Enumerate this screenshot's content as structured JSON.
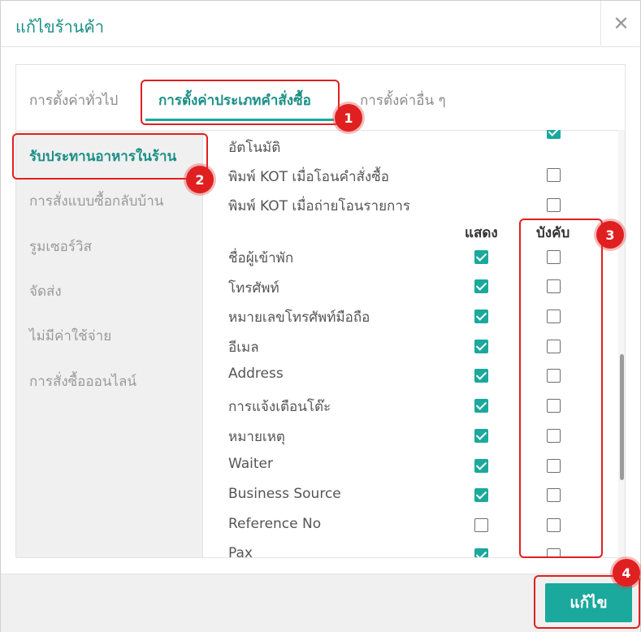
{
  "dialog": {
    "title": "แก้ไขร้านค้า",
    "close_symbol": "✕"
  },
  "tabs": [
    {
      "label": "การตั้งค่าทั่วไป",
      "active": false
    },
    {
      "label": "การตั้งค่าประเภทคำสั่งซื้อ",
      "active": true
    },
    {
      "label": "การตั้งค่าอื่น ๆ",
      "active": false
    }
  ],
  "sidebar": {
    "items": [
      {
        "label": "รับประทานอาหารในร้าน",
        "active": true
      },
      {
        "label": "การสั่งแบบซื้อกลับบ้าน",
        "active": false
      },
      {
        "label": "รูมเซอร์วิส",
        "active": false
      },
      {
        "label": "จัดส่ง",
        "active": false
      },
      {
        "label": "ไม่มีค่าใช้จ่าย",
        "active": false
      },
      {
        "label": "การสั่งซื้อออนไลน์",
        "active": false
      }
    ]
  },
  "settings": [
    {
      "label": "อัตโนมัติ",
      "checked": true
    },
    {
      "label": "พิมพ์ KOT เมื่อโอนคำสั่งซื้อ",
      "checked": false
    },
    {
      "label": "พิมพ์ KOT เมื่อถ่ายโอนรายการ",
      "checked": false
    }
  ],
  "columns": {
    "show": "แสดง",
    "required": "บังคับ"
  },
  "fields": [
    {
      "label": "ชื่อผู้เข้าพัก",
      "show": true,
      "required": false
    },
    {
      "label": "โทรศัพท์",
      "show": true,
      "required": false
    },
    {
      "label": "หมายเลขโทรศัพท์มือถือ",
      "show": true,
      "required": false
    },
    {
      "label": "อีเมล",
      "show": true,
      "required": false
    },
    {
      "label": "Address",
      "show": true,
      "required": false
    },
    {
      "label": "การแจ้งเตือนโต๊ะ",
      "show": true,
      "required": false
    },
    {
      "label": "หมายเหตุ",
      "show": true,
      "required": false
    },
    {
      "label": "Waiter",
      "show": true,
      "required": false
    },
    {
      "label": "Business Source",
      "show": true,
      "required": false
    },
    {
      "label": "Reference No",
      "show": false,
      "required": false
    },
    {
      "label": "Pax",
      "show": true,
      "required": false
    }
  ],
  "footer": {
    "save_label": "แก้ไข"
  },
  "annotations": [
    "1",
    "2",
    "3",
    "4"
  ],
  "colors": {
    "accent": "#1aa99c",
    "title": "#1a8f86",
    "highlight": "#e02020"
  }
}
